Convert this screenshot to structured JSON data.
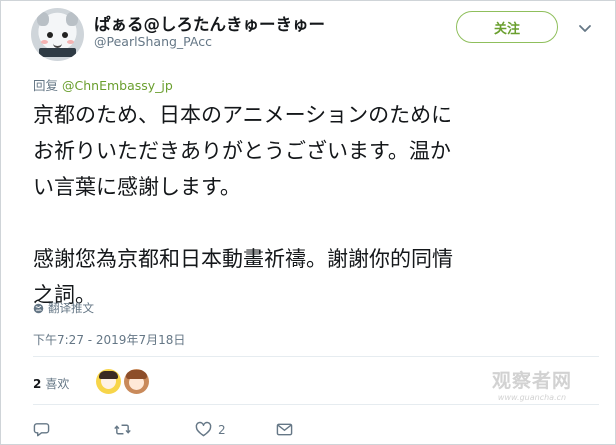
{
  "tweet": {
    "display_name": "ぱぁる@しろたんきゅーきゅー",
    "handle": "@PearlShang_PAcc",
    "follow_label": "关注",
    "reply_prefix": "回复",
    "reply_to": "@ChnEmbassy_jp",
    "text_ja": "京都のため、日本のアニメーションのために\nお祈りいただきありがとうございます。温か\nい言葉に感謝します。",
    "text_zh": "感謝您為京都和日本動畫祈禱。謝謝你的同情\n之詞。",
    "translate_label": "翻译推文",
    "timestamp": "下午7:27 - 2019年7月18日",
    "likes_count": "2",
    "likes_label": "喜欢",
    "reply_count": "",
    "retweet_count": "",
    "like_action_count": "2"
  },
  "watermark": {
    "title": "观察者网",
    "url": "www.guancha.cn"
  },
  "colors": {
    "accent": "#6a9f2e",
    "muted": "#657786",
    "text": "#14171a"
  },
  "icons": [
    "avatar",
    "chevron-down-icon",
    "globe-icon",
    "reply-icon",
    "retweet-icon",
    "heart-icon",
    "message-icon"
  ]
}
